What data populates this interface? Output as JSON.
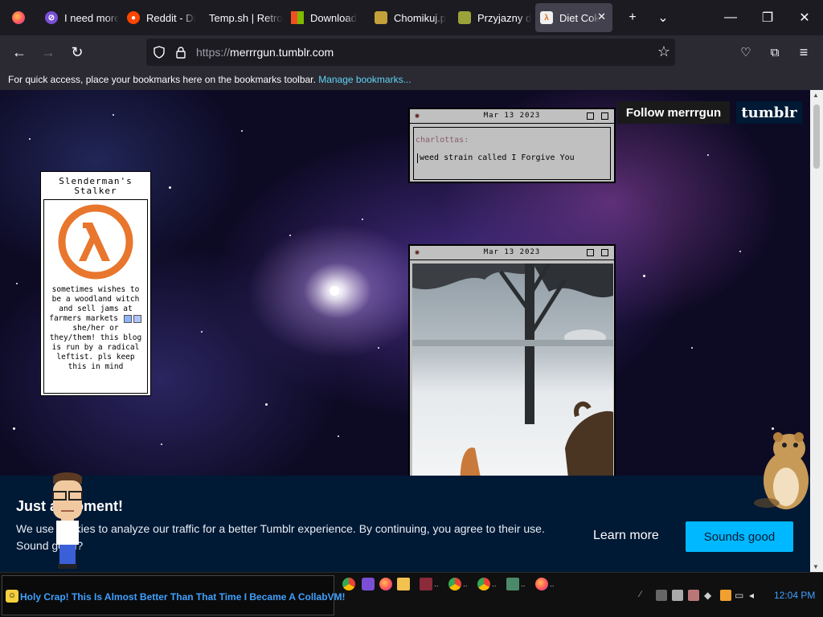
{
  "browser": {
    "tabs": [
      {
        "label": "",
        "icon": "firefox-icon",
        "active": false
      },
      {
        "label": "I need more",
        "icon": "ai-chat-icon",
        "active": false
      },
      {
        "label": "Reddit - Di",
        "icon": "reddit-icon",
        "active": false
      },
      {
        "label": "Temp.sh | Retro",
        "icon": "none",
        "active": false
      },
      {
        "label": "Download",
        "icon": "microsoft-icon",
        "active": false
      },
      {
        "label": "Chomikuj.p",
        "icon": "chomikuj-icon",
        "active": false
      },
      {
        "label": "Przyjazny d",
        "icon": "game-icon",
        "active": false
      },
      {
        "label": "Diet Cok",
        "icon": "half-life-icon",
        "active": true
      }
    ],
    "new_tab_label": "+",
    "list_tabs_label": "⌄",
    "window_controls": {
      "minimize": "—",
      "maximize": "❐",
      "close": "✕"
    },
    "url_prefix": "https://",
    "url_host": "merrrgun.tumblr.com",
    "bookmarks_text": "For quick access, place your bookmarks here on the bookmarks toolbar.",
    "bookmarks_link": "Manage bookmarks..."
  },
  "page": {
    "sidebar": {
      "title": "Slenderman's Stalker",
      "avatar": "half-life-lambda-logo",
      "description_1": "sometimes wishes to be a woodland witch and sell jams at farmers markets",
      "description_2": "she/her or they/them! this blog is run by a radical leftist. pls keep this in mind"
    },
    "posts": [
      {
        "date": "Mar 13 2023",
        "author": "charlottas:",
        "text": "weed strain called I Forgive You"
      },
      {
        "date": "Mar 13 2023",
        "media": "snowy yard with tree and dogs"
      }
    ],
    "follow_label": "Follow merrrgun",
    "tumblr_logo": "tumblr",
    "colors": {
      "banner": "#001935",
      "button": "#00b8ff",
      "link": "#5fd3f5"
    }
  },
  "cookie_banner": {
    "title": "Just a moment!",
    "body": "We use cookies to analyze our traffic for a better Tumblr experience. By continuing, you agree to their use. Sound good?",
    "learn_more": "Learn more",
    "accept": "Sounds good"
  },
  "taskbar": {
    "ticker": "Holy Crap! This Is Almost Better Than That Time I Became A CollabVM!",
    "time": "12:04 PM"
  }
}
